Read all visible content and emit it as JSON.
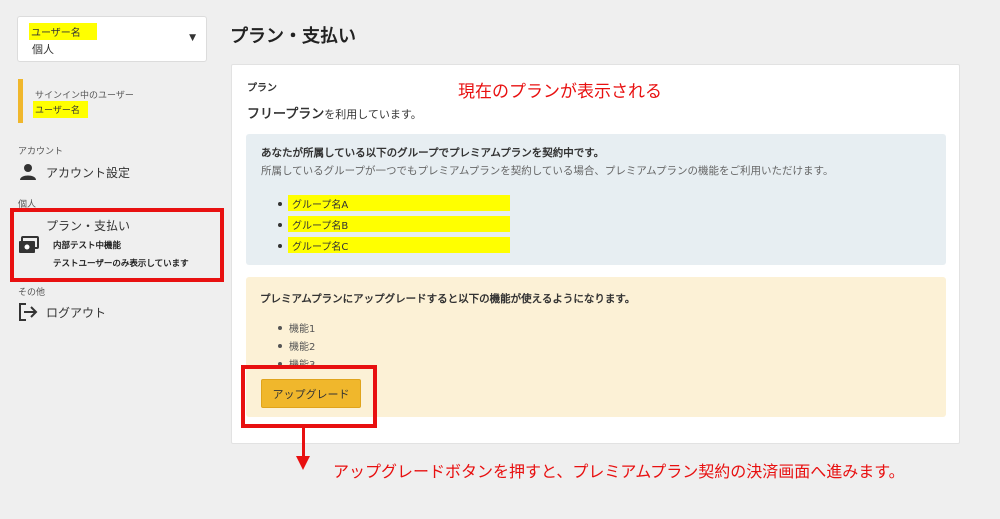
{
  "sidebar": {
    "user_select": {
      "username": "ユーザー名",
      "scope": "個人"
    },
    "signin": {
      "label": "サインイン中のユーザー",
      "username": "ユーザー名"
    },
    "sections": {
      "account": "アカウント",
      "personal": "個人",
      "other": "その他"
    },
    "items": {
      "account_settings": "アカウント設定",
      "plan": "プラン・支払い",
      "plan_note1": "内部テスト中機能",
      "plan_note2": "テストユーザーのみ表示しています",
      "logout": "ログアウト"
    }
  },
  "main": {
    "title": "プラン・支払い",
    "card": {
      "plan_label": "プラン",
      "current_plan_name": "フリープラン",
      "current_plan_suffix": "を利用しています。",
      "annotation_current": "現在のプランが表示される",
      "info": {
        "heading": "あなたが所属している以下のグループでプレミアムプランを契約中です。",
        "description": "所属しているグループが一つでもプレミアムプランを契約している場合、プレミアムプランの機能をご利用いただけます。",
        "groups": [
          "グループ名A",
          "グループ名B",
          "グループ名C"
        ]
      },
      "upgrade": {
        "heading": "プレミアムプランにアップグレードすると以下の機能が使えるようになります。",
        "features": [
          "機能1",
          "機能2",
          "機能3"
        ],
        "button_label": "アップグレード"
      }
    },
    "annotation_bottom": "アップグレードボタンを押すと、プレミアムプラン契約の決済画面へ進みます。"
  },
  "colors": {
    "accent": "#f0b72c",
    "annotation_red": "#e81010",
    "highlight": "#ffff00",
    "info_bg": "#e7eef2",
    "upgrade_bg": "#fcf1d6"
  }
}
